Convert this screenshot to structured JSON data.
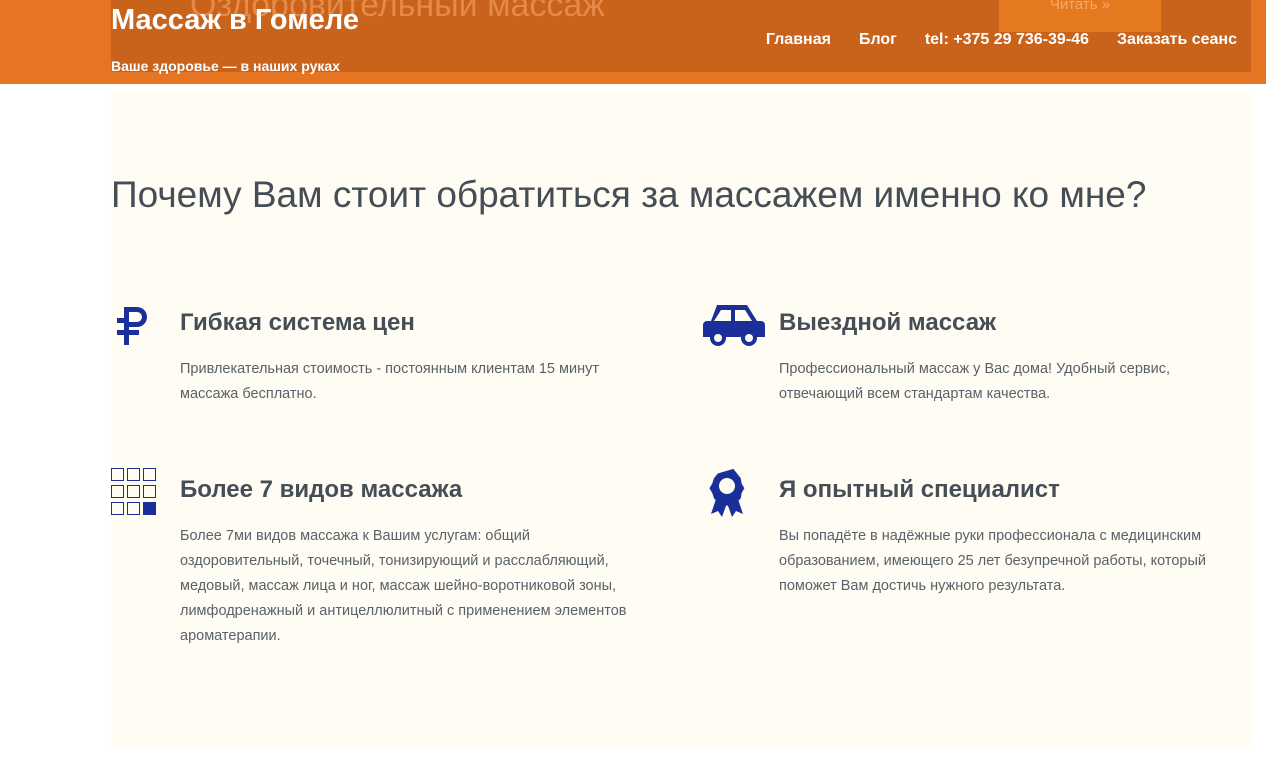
{
  "header": {
    "background_text": "Оздоровительный массаж",
    "background_button": "Читать »",
    "title": "Массаж в Гомеле",
    "tagline": "Ваше здоровье — в наших руках",
    "nav": [
      {
        "label": "Главная"
      },
      {
        "label": "Блог"
      },
      {
        "label": "tel: +375 29 736-39-46"
      },
      {
        "label": "Заказать сеанс"
      }
    ]
  },
  "main": {
    "heading": "Почему Вам стоит обратиться за массажем именно ко мне?",
    "features": [
      {
        "icon": "ruble-icon",
        "title": "Гибкая система цен",
        "text": "Привлекательная стоимость - постоянным клиентам 15 минут массажа бесплатно."
      },
      {
        "icon": "car-icon",
        "title": "Выездной массаж",
        "text": "Профессиональный массаж у Вас дома! Удобный сервис, отвечающий всем стандартам качества."
      },
      {
        "icon": "grid-icon",
        "title": "Более 7 видов массажа",
        "text": "Более 7ми видов массажа к Вашим услугам: общий оздоровительный, точечный, тонизирующий и расслабляющий, медовый, массаж лица и ног, массаж шейно-воротниковой зоны, лимфодренажный и антицеллюлитный с применением элементов ароматерапии."
      },
      {
        "icon": "award-icon",
        "title": "Я опытный специалист",
        "text": "Вы попадёте в надёжные руки профессионала с медицинским образованием, имеющего 25 лет безупречной работы, который поможет Вам достичь нужного результата."
      }
    ]
  },
  "colors": {
    "header": "#e57423",
    "header_inner": "#c9621a",
    "icon": "#1a2f9a",
    "heading": "#454e57",
    "content_bg": "#fffcf3"
  }
}
